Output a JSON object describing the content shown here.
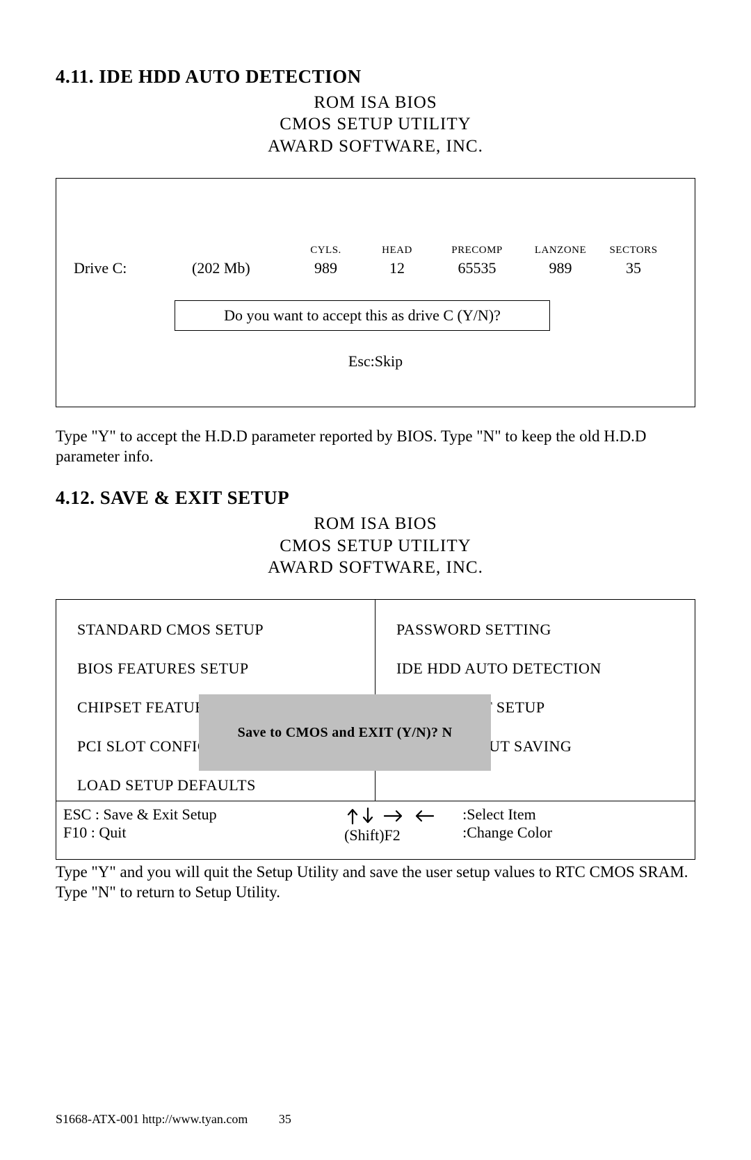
{
  "section411": {
    "title": "4.11. IDE HDD AUTO DETECTION",
    "bios_line1": "ROM ISA BIOS",
    "bios_line2": "CMOS SETUP UTILITY",
    "bios_line3": "AWARD SOFTWARE, INC.",
    "headers": {
      "cyls": "CYLS.",
      "head": "HEAD",
      "precomp": "PRECOMP",
      "lanzone": "LANZONE",
      "sectors": "SECTORS"
    },
    "row": {
      "drive": "Drive C:",
      "size": "(202 Mb)",
      "cyls": "989",
      "head": "12",
      "precomp": "65535",
      "lanzone": "989",
      "sectors": "35"
    },
    "prompt": "Do you want to accept this as drive C (Y/N)?",
    "esc": "Esc:Skip",
    "explain": "Type \"Y\" to accept the H.D.D parameter reported by BIOS.  Type \"N\" to keep the old H.D.D parameter info."
  },
  "section412": {
    "title": "4.12. SAVE & EXIT SETUP",
    "bios_line1": "ROM ISA BIOS",
    "bios_line2": "CMOS SETUP UTILITY",
    "bios_line3": "AWARD SOFTWARE, INC.",
    "left_items": [
      "STANDARD CMOS SETUP",
      "BIOS FEATURES SETUP",
      "CHIPSET FEATURES SETUP",
      "PCI SLOT CONFIGURATION",
      "LOAD SETUP DEFAULTS"
    ],
    "right_items": [
      "PASSWORD SETTING",
      "IDE HDD AUTO DETECTION",
      "SAVE & EXIT SETUP",
      "EXIT WITHOUT SAVING"
    ],
    "dialog": "Save to CMOS and EXIT (Y/N)? N",
    "lower": {
      "esc": "ESC : Save & Exit Setup",
      "f10": "F10  : Quit",
      "shift": "(Shift)F2",
      "select": ":Select Item",
      "color": ":Change Color"
    },
    "explain": "Type \"Y\" and you will quit the Setup Utility and save the user setup values to RTC CMOS SRAM.  Type \"N\" to return to Setup Utility."
  },
  "footer": {
    "model": "S1668-ATX-001",
    "url": "http://www.tyan.com",
    "page": "35"
  }
}
